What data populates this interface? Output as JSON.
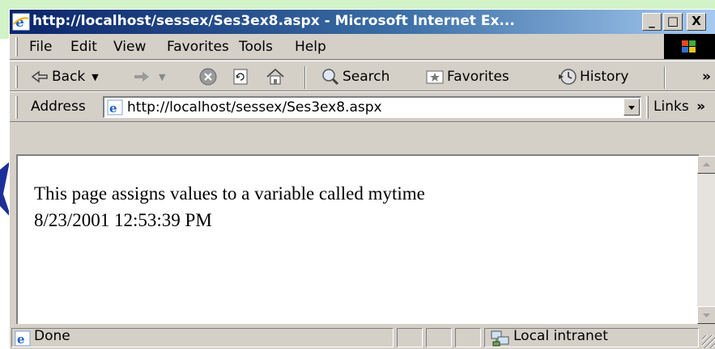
{
  "window": {
    "title": "http://localhost/sessex/Ses3ex8.aspx - Microsoft Internet Ex..."
  },
  "title_buttons": {
    "minimize": "_",
    "maximize": "□",
    "close": "X"
  },
  "menu": {
    "items": [
      "File",
      "Edit",
      "View",
      "Favorites",
      "Tools",
      "Help"
    ]
  },
  "toolbar": {
    "back": "Back",
    "search": "Search",
    "favorites": "Favorites",
    "history": "History",
    "more": "»"
  },
  "address": {
    "label": "Address",
    "url": "http://localhost/sessex/Ses3ex8.aspx",
    "links_label": "Links",
    "more": "»"
  },
  "page": {
    "lines": [
      "This page assigns values to a variable called mytime",
      "8/23/2001 12:53:39 PM"
    ]
  },
  "status": {
    "text": "Done",
    "zone": "Local intranet"
  },
  "colors": {
    "background_band": "#d2f2c7",
    "title_start": "#0a246a",
    "title_end": "#a6caf0",
    "chrome": "#d4d0c8"
  },
  "icons": [
    "ie-icon",
    "back-arrow-icon",
    "forward-arrow-icon",
    "stop-icon",
    "refresh-icon",
    "home-icon",
    "search-icon",
    "favorites-icon",
    "history-icon",
    "windows-logo-icon",
    "page-icon",
    "local-intranet-icon"
  ]
}
